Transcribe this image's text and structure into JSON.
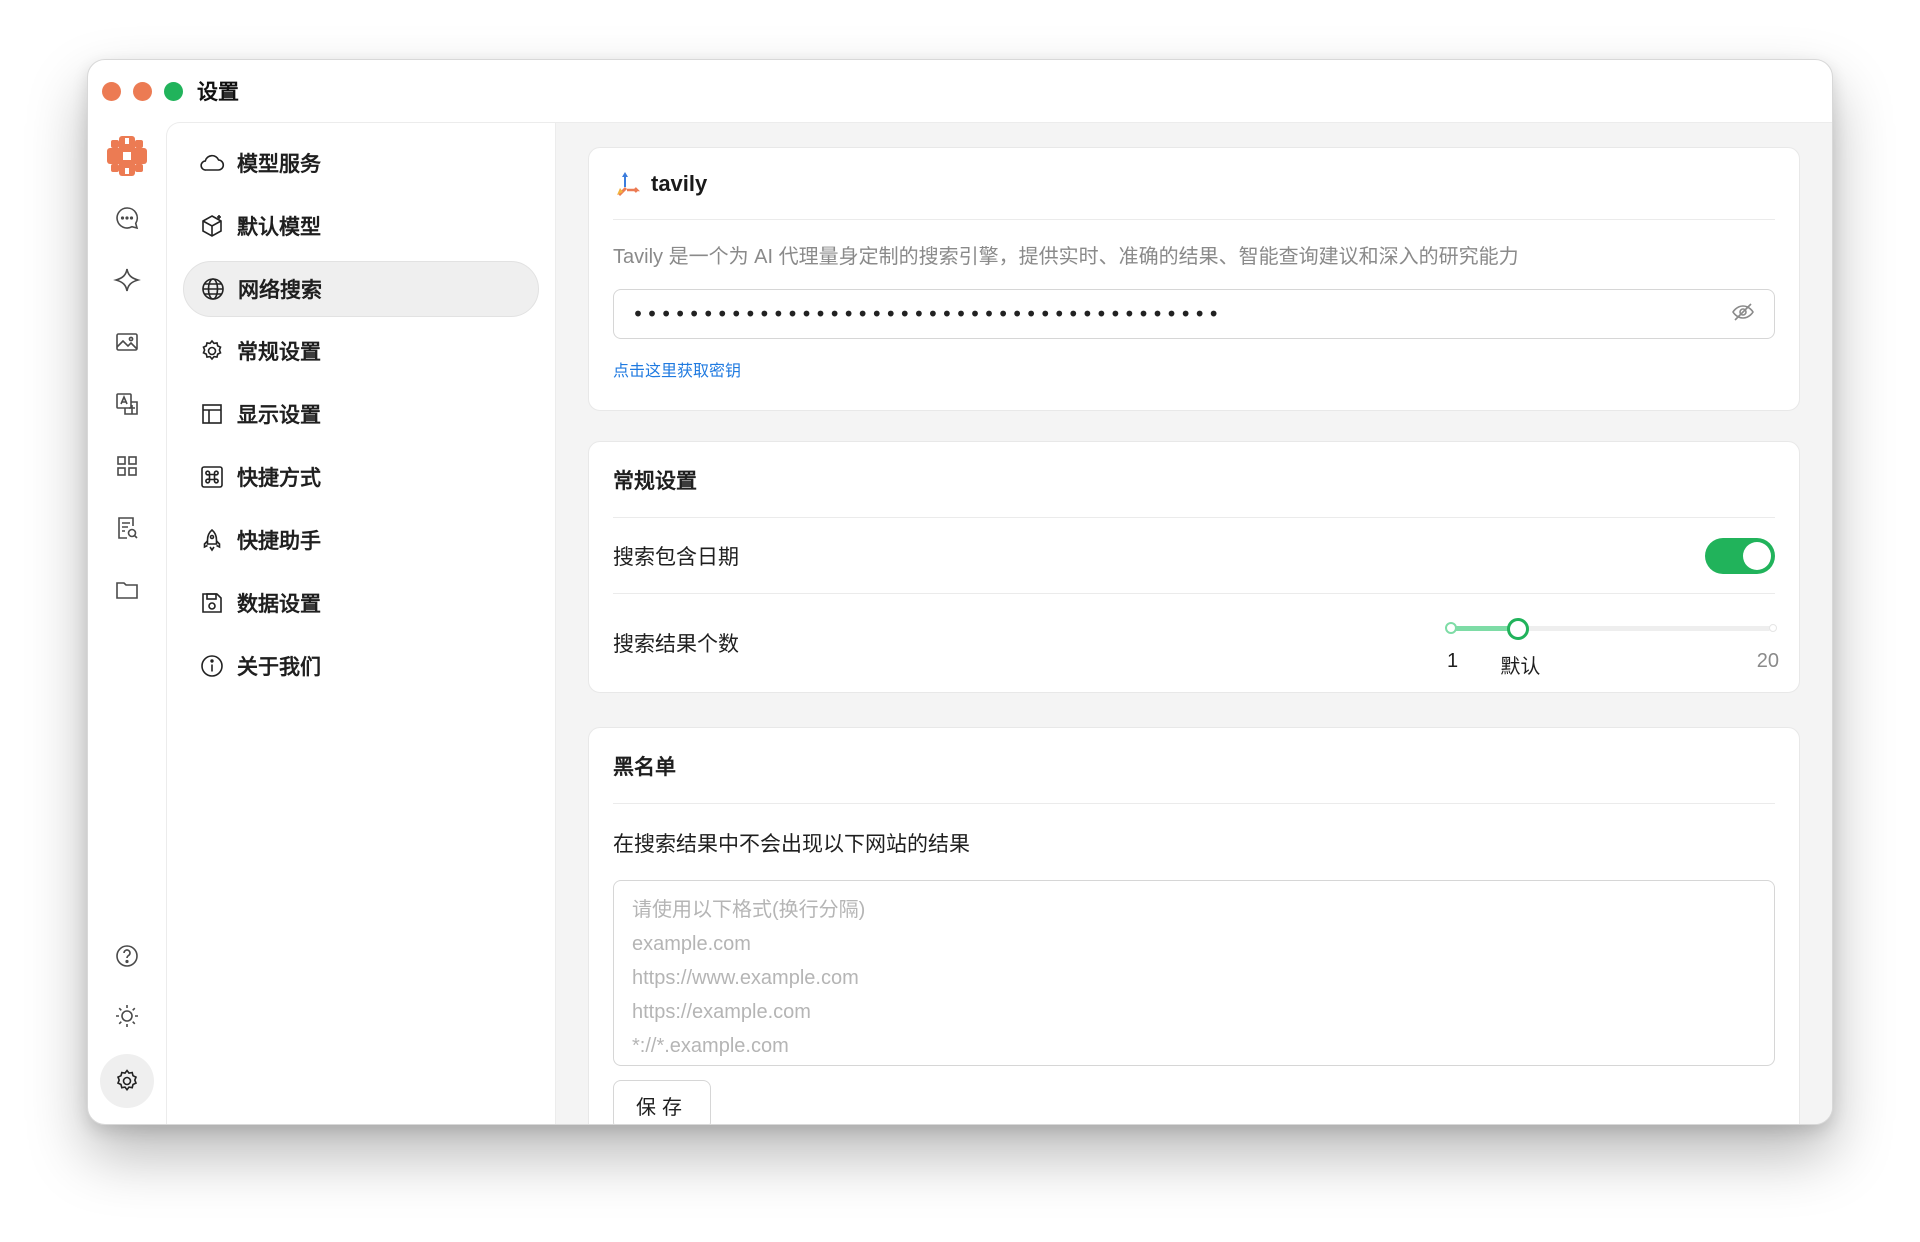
{
  "window": {
    "title": "设置"
  },
  "rail": {
    "items": [
      {
        "name": "chat-icon"
      },
      {
        "name": "sparkle-icon"
      },
      {
        "name": "image-icon"
      },
      {
        "name": "translate-icon"
      },
      {
        "name": "apps-grid-icon"
      },
      {
        "name": "document-search-icon"
      },
      {
        "name": "folder-icon"
      }
    ],
    "bottom": [
      {
        "name": "help-icon"
      },
      {
        "name": "sun-icon"
      },
      {
        "name": "settings-gear-icon",
        "active": true
      }
    ]
  },
  "nav": {
    "items": [
      {
        "label": "模型服务",
        "icon": "cloud-icon"
      },
      {
        "label": "默认模型",
        "icon": "cube-icon"
      },
      {
        "label": "网络搜索",
        "icon": "globe-icon",
        "active": true
      },
      {
        "label": "常规设置",
        "icon": "gear-icon"
      },
      {
        "label": "显示设置",
        "icon": "layout-icon"
      },
      {
        "label": "快捷方式",
        "icon": "command-icon"
      },
      {
        "label": "快捷助手",
        "icon": "rocket-icon"
      },
      {
        "label": "数据设置",
        "icon": "save-icon"
      },
      {
        "label": "关于我们",
        "icon": "info-icon"
      }
    ]
  },
  "provider": {
    "name": "tavily",
    "description": "Tavily 是一个为 AI 代理量身定制的搜索引擎，提供实时、准确的结果、智能查询建议和深入的研究能力",
    "api_key_masked": "••••••••••••••••••••••••••••••••••••••••••",
    "get_key_link": "点击这里获取密钥"
  },
  "general": {
    "title": "常规设置",
    "include_date_label": "搜索包含日期",
    "include_date_on": true,
    "result_count_label": "搜索结果个数",
    "slider": {
      "min": 1,
      "max": 20,
      "value": 5,
      "min_label": "1",
      "default_label": "默认",
      "max_label": "20"
    }
  },
  "blacklist": {
    "title": "黑名单",
    "description": "在搜索结果中不会出现以下网站的结果",
    "placeholder_lines": [
      "请使用以下格式(换行分隔)",
      "example.com",
      "https://www.example.com",
      "https://example.com",
      "*://*.example.com"
    ],
    "save_label": "保存"
  },
  "colors": {
    "accent_green": "#21b35b",
    "traffic_red": "#ec7b53",
    "link_blue": "#1f7ae0"
  }
}
